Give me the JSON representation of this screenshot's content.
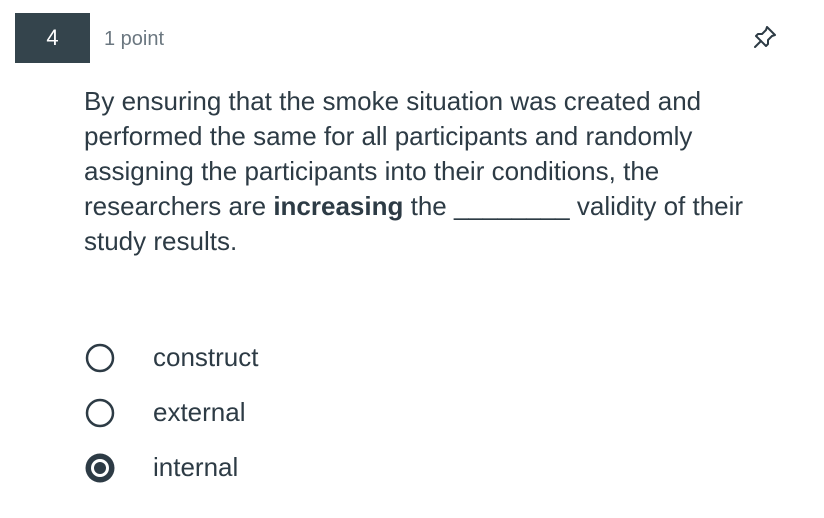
{
  "question": {
    "number": "4",
    "points": "1 point",
    "text_before": "By ensuring that the smoke situation was created and performed the same for all participants and randomly assigning the participants into their conditions, the researchers are ",
    "text_bold": "increasing",
    "text_after": " the ________ validity of their study results."
  },
  "icons": {
    "pin": "pin-icon",
    "radio_unselected": "radio-unselected-icon",
    "radio_selected": "radio-selected-icon"
  },
  "answers": [
    {
      "label": "construct",
      "selected": false
    },
    {
      "label": "external",
      "selected": false
    },
    {
      "label": "internal",
      "selected": true
    }
  ],
  "colors": {
    "number_badge": "#34444c",
    "text": "#2d3b45",
    "muted": "#6b7780"
  }
}
